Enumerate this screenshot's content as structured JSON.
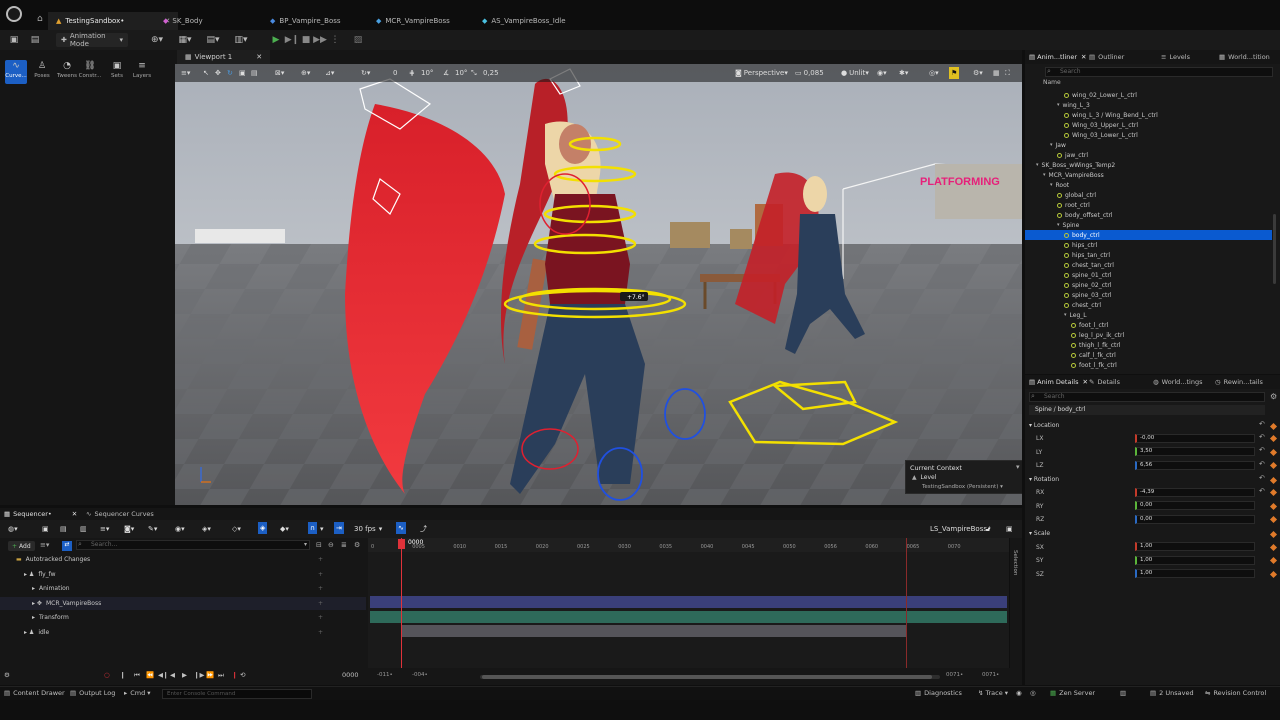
{
  "tabs": [
    {
      "label": "TestingSandbox•",
      "active": true
    },
    {
      "label": "SK_Body"
    },
    {
      "label": "BP_Vampire_Boss"
    },
    {
      "label": "MCR_VampireBoss"
    },
    {
      "label": "AS_VampireBoss_Idle"
    }
  ],
  "toolbar": {
    "mode_label": "Animation Mode"
  },
  "modes": [
    "Curve...",
    "Poses",
    "Tweens",
    "Constr...",
    "Sets",
    "Layers"
  ],
  "viewport": {
    "tab_label": "Viewport 1",
    "snap_angle_value": "0",
    "snap_a": "10°",
    "snap_b": "10°",
    "snap_scale": "0,25",
    "perspective_label": "Perspective",
    "speed_value": "0,085",
    "lit_label": "Unlit",
    "gizmo_readout": "+7.6°",
    "sign_text": "PLATFORMING"
  },
  "context": {
    "title": "Current Context",
    "level_label": "Level",
    "level_value": "TestingSandbox (Persistent)"
  },
  "right_top_tabs": [
    "Anim...tliner",
    "Outliner",
    "Levels",
    "World...tition"
  ],
  "outliner": {
    "search_placeholder": "Search",
    "column_header": "Name",
    "rows": [
      {
        "label": "wing_02_Lower_L_ctrl",
        "indent": 5,
        "icon": "bone"
      },
      {
        "label": "wing_L_3",
        "indent": 4,
        "icon": "fold"
      },
      {
        "label": "wing_L_3 / Wing_Bend_L_ctrl",
        "indent": 5,
        "icon": "bone"
      },
      {
        "label": "Wing_03_Upper_L_ctrl",
        "indent": 5,
        "icon": "bone"
      },
      {
        "label": "Wing_03_Lower_L_ctrl",
        "indent": 5,
        "icon": "bone"
      },
      {
        "label": "Jaw",
        "indent": 3,
        "icon": "fold"
      },
      {
        "label": "jaw_ctrl",
        "indent": 4,
        "icon": "bone"
      },
      {
        "label": "SK_Boss_wWings_Temp2",
        "indent": 1,
        "icon": "fold"
      },
      {
        "label": "MCR_VampireBoss",
        "indent": 2,
        "icon": "fold"
      },
      {
        "label": "Root",
        "indent": 3,
        "icon": "fold"
      },
      {
        "label": "global_ctrl",
        "indent": 4,
        "icon": "bone"
      },
      {
        "label": "root_ctrl",
        "indent": 4,
        "icon": "bone"
      },
      {
        "label": "body_offset_ctrl",
        "indent": 4,
        "icon": "bone"
      },
      {
        "label": "Spine",
        "indent": 4,
        "icon": "fold"
      },
      {
        "label": "body_ctrl",
        "indent": 5,
        "icon": "bone",
        "selected": true
      },
      {
        "label": "hips_ctrl",
        "indent": 5,
        "icon": "bone"
      },
      {
        "label": "hips_tan_ctrl",
        "indent": 5,
        "icon": "bone"
      },
      {
        "label": "chest_tan_ctrl",
        "indent": 5,
        "icon": "bone"
      },
      {
        "label": "spine_01_ctrl",
        "indent": 5,
        "icon": "bone"
      },
      {
        "label": "spine_02_ctrl",
        "indent": 5,
        "icon": "bone"
      },
      {
        "label": "spine_03_ctrl",
        "indent": 5,
        "icon": "bone"
      },
      {
        "label": "chest_ctrl",
        "indent": 5,
        "icon": "bone"
      },
      {
        "label": "Leg_L",
        "indent": 5,
        "icon": "fold"
      },
      {
        "label": "foot_l_ctrl",
        "indent": 6,
        "icon": "bone"
      },
      {
        "label": "leg_l_pv_ik_ctrl",
        "indent": 6,
        "icon": "bone"
      },
      {
        "label": "thigh_l_fk_ctrl",
        "indent": 6,
        "icon": "bone"
      },
      {
        "label": "calf_l_fk_ctrl",
        "indent": 6,
        "icon": "bone"
      },
      {
        "label": "foot_l_fk_ctrl",
        "indent": 6,
        "icon": "bone"
      }
    ]
  },
  "right_bottom_tabs": [
    "Anim Details",
    "Details",
    "World...tings",
    "Rewin...tails"
  ],
  "details": {
    "search_placeholder": "Search",
    "path": "Spine / body_ctrl",
    "location": {
      "label": "Location",
      "lx": "LX",
      "lx_value": "-0,00",
      "ly": "LY",
      "ly_value": "3,50",
      "lz": "LZ",
      "lz_value": "6,56"
    },
    "rotation": {
      "label": "Rotation",
      "rx": "RX",
      "rx_value": "-4,39",
      "ry": "RY",
      "ry_value": "0,00",
      "rz": "RZ",
      "rz_value": "0,00"
    },
    "scale": {
      "label": "Scale",
      "sx": "SX",
      "sx_value": "1,00",
      "sy": "SY",
      "sy_value": "1,00",
      "sz": "SZ",
      "sz_value": "1,00"
    }
  },
  "sequencer": {
    "tab1": "Sequencer•",
    "tab2": "Sequencer Curves",
    "fps_label": "30 fps",
    "sequence_name": "LS_VampireBoss•",
    "add_label": "Add",
    "search_placeholder": "Search...",
    "tracks": [
      {
        "label": "Autotracked Changes",
        "indent": 1,
        "kind": "folder"
      },
      {
        "label": "fly_fw",
        "indent": 2,
        "kind": "actor"
      },
      {
        "label": "Animation",
        "indent": 3,
        "kind": "plain"
      },
      {
        "label": "MCR_VampireBoss",
        "indent": 3,
        "kind": "rig"
      },
      {
        "label": "Transform",
        "indent": 3,
        "kind": "plain"
      },
      {
        "label": "idle",
        "indent": 2,
        "kind": "actor"
      }
    ],
    "current_frame": "0000",
    "ticks": [
      "0",
      "0005",
      "0010",
      "0015",
      "0020",
      "0025",
      "0030",
      "0035",
      "0040",
      "0045",
      "0050",
      "0056",
      "0060",
      "0065",
      "0070"
    ],
    "frame_field": "0000",
    "range_start": "-011•",
    "range_start2": "-004•",
    "range_end1": "0071•",
    "range_end2": "0071•",
    "side_label": "Selection"
  },
  "statusbar": {
    "content_drawer": "Content Drawer",
    "output_log": "Output Log",
    "cmd": "Cmd",
    "console_placeholder": "Enter Console Command",
    "diagnostics": "Diagnostics",
    "trace": "Trace",
    "zen": "Zen Server",
    "unsaved": "2 Unsaved",
    "revision": "Revision Control"
  },
  "colors": {
    "accent": "#1c5fc4",
    "selection": "#0a5ad0",
    "key_orange": "#e07a2a",
    "playhead": "#e0323a",
    "control_yellow": "#f3e000"
  }
}
